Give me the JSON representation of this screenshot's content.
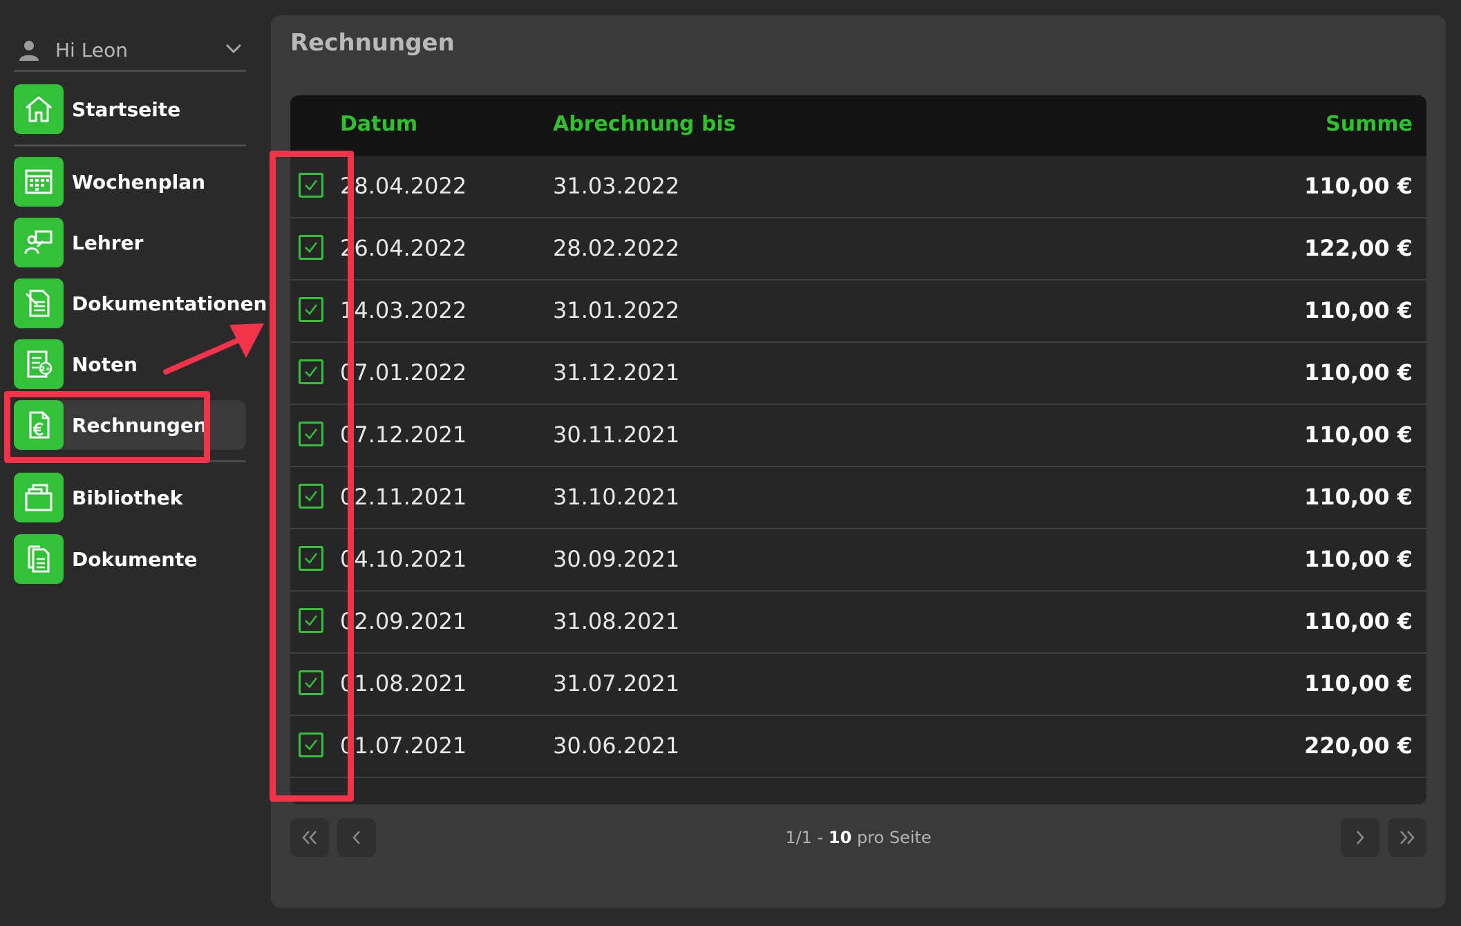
{
  "user": {
    "greeting": "Hi Leon"
  },
  "nav": {
    "items": [
      {
        "label": "Startseite",
        "icon": "home-icon"
      },
      {
        "label": "Wochenplan",
        "icon": "calendar-icon"
      },
      {
        "label": "Lehrer",
        "icon": "teacher-icon"
      },
      {
        "label": "Dokumentationen",
        "icon": "documentation-icon"
      },
      {
        "label": "Noten",
        "icon": "grades-icon"
      },
      {
        "label": "Rechnungen",
        "icon": "invoice-euro-icon"
      },
      {
        "label": "Bibliothek",
        "icon": "library-icon"
      },
      {
        "label": "Dokumente",
        "icon": "documents-icon"
      }
    ],
    "active": "Rechnungen"
  },
  "main": {
    "title": "Rechnungen",
    "columns": {
      "date": "Datum",
      "billing_until": "Abrechnung bis",
      "sum": "Summe"
    },
    "rows": [
      {
        "date": "28.04.2022",
        "billing_until": "31.03.2022",
        "sum": "110,00 €"
      },
      {
        "date": "26.04.2022",
        "billing_until": "28.02.2022",
        "sum": "122,00 €"
      },
      {
        "date": "14.03.2022",
        "billing_until": "31.01.2022",
        "sum": "110,00 €"
      },
      {
        "date": "07.01.2022",
        "billing_until": "31.12.2021",
        "sum": "110,00 €"
      },
      {
        "date": "07.12.2021",
        "billing_until": "30.11.2021",
        "sum": "110,00 €"
      },
      {
        "date": "02.11.2021",
        "billing_until": "31.10.2021",
        "sum": "110,00 €"
      },
      {
        "date": "04.10.2021",
        "billing_until": "30.09.2021",
        "sum": "110,00 €"
      },
      {
        "date": "02.09.2021",
        "billing_until": "31.08.2021",
        "sum": "110,00 €"
      },
      {
        "date": "01.08.2021",
        "billing_until": "31.07.2021",
        "sum": "110,00 €"
      },
      {
        "date": "01.07.2021",
        "billing_until": "30.06.2021",
        "sum": "220,00 €"
      }
    ]
  },
  "pagination": {
    "page_info": "1/1 -",
    "per_page_value": "10",
    "per_page_label": "pro Seite"
  },
  "colors": {
    "accent_green": "#34c13a",
    "annotation_red": "#f2334a"
  }
}
